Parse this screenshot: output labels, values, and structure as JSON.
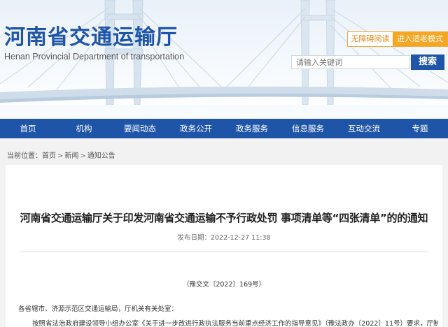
{
  "header": {
    "site_title": "河南省交通运输厅",
    "site_subtitle": "Henan Provincial Department of transportation",
    "accessibility_label": "无障碍阅读",
    "elder_mode_label": "进入适老模式",
    "search_placeholder": "请输入关键词",
    "search_label": "搜索"
  },
  "nav": {
    "items": [
      "首页",
      "机构",
      "要闻动态",
      "政务公开",
      "政务服务",
      "信息服务",
      "互动交流",
      "专题"
    ]
  },
  "breadcrumb": {
    "prefix": "当前位置：",
    "items": [
      "首页",
      "新闻",
      "通知公告"
    ],
    "separator": ">"
  },
  "article": {
    "title": "河南省交通运输厅关于印发河南省交通运输不予行政处罚 事项清单等“四张清单”的的通知",
    "publish_label": "发布日期：",
    "publish_date": "2022-12-27 11:38",
    "doc_number": "（豫交文〔2022〕169号）",
    "recipient": "各省辖市、济源示范区交通运输局，厅机关有关处室：",
    "body_first_line": "按照省法治政府建设领导小组办公室《关于进一步改进行政执法服务当前重点经济工作的指导意见》（豫法政办〔2022〕11号）要求，厅制定了《河南"
  },
  "colors": {
    "brand_blue": "#1f55a8",
    "accent_orange": "#f5a623",
    "page_bg": "#f2f2f2"
  }
}
